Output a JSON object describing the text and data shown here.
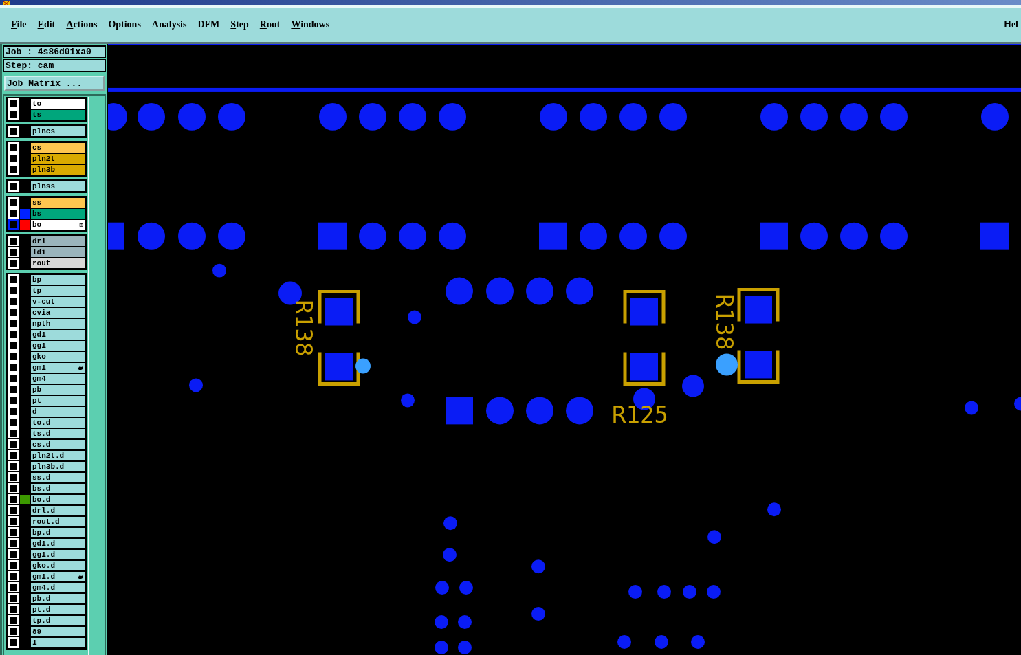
{
  "menu": [
    {
      "label": "File",
      "underlined": true
    },
    {
      "label": "Edit",
      "underlined": true
    },
    {
      "label": "Actions",
      "underlined": true
    },
    {
      "label": "Options",
      "underlined": false
    },
    {
      "label": "Analysis",
      "underlined": false
    },
    {
      "label": "DFM",
      "underlined": false
    },
    {
      "label": "Step",
      "underlined": true
    },
    {
      "label": "Rout",
      "underlined": true
    },
    {
      "label": "Windows",
      "underlined": true
    }
  ],
  "help_menu": "Hel",
  "job": "Job : 4s86d01xa0",
  "step": "Step: cam",
  "job_matrix_button": "Job Matrix ...",
  "layer_groups": [
    {
      "layers": [
        {
          "name": "to",
          "kind": "overlay",
          "selected": false
        },
        {
          "name": "ts",
          "kind": "mask",
          "selected": false
        }
      ]
    },
    {
      "layers": [
        {
          "name": "plncs",
          "kind": "misc",
          "selected": false
        }
      ]
    },
    {
      "layers": [
        {
          "name": "cs",
          "kind": "outer",
          "selected": false
        },
        {
          "name": "pln2t",
          "kind": "inner",
          "selected": false
        },
        {
          "name": "pln3b",
          "kind": "inner",
          "selected": false
        }
      ]
    },
    {
      "layers": [
        {
          "name": "plnss",
          "kind": "misc",
          "selected": false
        }
      ]
    },
    {
      "layers": [
        {
          "name": "ss",
          "kind": "outer",
          "selected": false
        },
        {
          "name": "bs",
          "kind": "mask",
          "selected": false,
          "color": "#0022ff"
        },
        {
          "name": "bo",
          "kind": "overlay",
          "selected": true,
          "color": "#ff0000",
          "badge": "⊞"
        }
      ]
    },
    {
      "layers": [
        {
          "name": "drl",
          "kind": "drill",
          "selected": false
        },
        {
          "name": "ldi",
          "kind": "drill",
          "selected": false
        },
        {
          "name": "rout",
          "kind": "rout",
          "selected": false
        }
      ]
    },
    {
      "layers": [
        {
          "name": "bp",
          "kind": "misc",
          "selected": false
        },
        {
          "name": "tp",
          "kind": "misc",
          "selected": false
        },
        {
          "name": "v-cut",
          "kind": "misc",
          "selected": false
        },
        {
          "name": "cvia",
          "kind": "misc",
          "selected": false
        },
        {
          "name": "npth",
          "kind": "misc",
          "selected": false
        },
        {
          "name": "gd1",
          "kind": "misc",
          "selected": false
        },
        {
          "name": "gg1",
          "kind": "misc",
          "selected": false
        },
        {
          "name": "gko",
          "kind": "misc",
          "selected": false
        },
        {
          "name": "gm1",
          "kind": "misc",
          "selected": false,
          "pointer": true
        },
        {
          "name": "gm4",
          "kind": "misc",
          "selected": false
        },
        {
          "name": "pb",
          "kind": "misc",
          "selected": false
        },
        {
          "name": "pt",
          "kind": "misc",
          "selected": false
        },
        {
          "name": "d",
          "kind": "misc",
          "selected": false
        },
        {
          "name": "to.d",
          "kind": "misc",
          "selected": false
        },
        {
          "name": "ts.d",
          "kind": "misc",
          "selected": false
        },
        {
          "name": "cs.d",
          "kind": "misc",
          "selected": false
        },
        {
          "name": "pln2t.d",
          "kind": "misc",
          "selected": false
        },
        {
          "name": "pln3b.d",
          "kind": "misc",
          "selected": false
        },
        {
          "name": "ss.d",
          "kind": "misc",
          "selected": false
        },
        {
          "name": "bs.d",
          "kind": "misc",
          "selected": false
        },
        {
          "name": "bo.d",
          "kind": "misc",
          "selected": false,
          "color": "#3c9900"
        },
        {
          "name": "drl.d",
          "kind": "misc",
          "selected": false
        },
        {
          "name": "rout.d",
          "kind": "misc",
          "selected": false
        },
        {
          "name": "bp.d",
          "kind": "misc",
          "selected": false
        },
        {
          "name": "gd1.d",
          "kind": "misc",
          "selected": false
        },
        {
          "name": "gg1.d",
          "kind": "misc",
          "selected": false
        },
        {
          "name": "gko.d",
          "kind": "misc",
          "selected": false
        },
        {
          "name": "gm1.d",
          "kind": "misc",
          "selected": false,
          "pointer": true
        },
        {
          "name": "gm4.d",
          "kind": "misc",
          "selected": false
        },
        {
          "name": "pb.d",
          "kind": "misc",
          "selected": false
        },
        {
          "name": "pt.d",
          "kind": "misc",
          "selected": false
        },
        {
          "name": "tp.d",
          "kind": "misc",
          "selected": false
        },
        {
          "name": "89",
          "kind": "misc",
          "selected": false
        },
        {
          "name": "1",
          "kind": "misc",
          "selected": false
        }
      ]
    }
  ],
  "silkscreen_labels": [
    "R138",
    "R138",
    "R125"
  ]
}
